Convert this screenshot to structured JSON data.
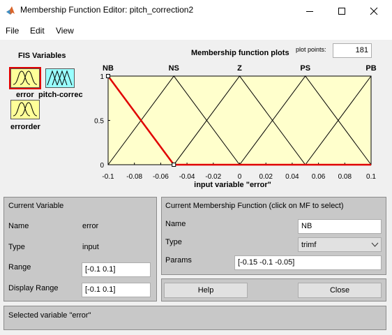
{
  "window": {
    "title": "Membership Function Editor: pitch_correction2"
  },
  "menu": [
    "File",
    "Edit",
    "View"
  ],
  "fis": {
    "heading": "FIS Variables",
    "vars": [
      {
        "label": "error",
        "color": "#ffff99",
        "selected": true
      },
      {
        "label": "pitch-correc",
        "color": "#99ffff",
        "selected": false
      },
      {
        "label": "errorder",
        "color": "#ffff99",
        "selected": false
      }
    ]
  },
  "plot": {
    "title": "Membership function plots",
    "plot_points_label": "plot points:",
    "plot_points_value": "181",
    "xlabel": "input variable \"error\"",
    "mf_labels": [
      "NB",
      "NS",
      "Z",
      "PS",
      "PB"
    ]
  },
  "chart_data": {
    "type": "line",
    "xlim": [
      -0.1,
      0.1
    ],
    "ylim": [
      0,
      1
    ],
    "xticks": [
      "-0.1",
      "-0.08",
      "-0.06",
      "-0.04",
      "-0.02",
      "0",
      "0.02",
      "0.04",
      "0.06",
      "0.08",
      "0.1"
    ],
    "yticks": [
      "0",
      "0.5",
      "1"
    ],
    "xlabel": "input variable \"error\"",
    "series": [
      {
        "name": "NB",
        "params": [
          -0.15,
          -0.1,
          -0.05
        ],
        "selected": true
      },
      {
        "name": "NS",
        "params": [
          -0.1,
          -0.05,
          0
        ],
        "selected": false
      },
      {
        "name": "Z",
        "params": [
          -0.05,
          0,
          0.05
        ],
        "selected": false
      },
      {
        "name": "PS",
        "params": [
          0,
          0.05,
          0.1
        ],
        "selected": false
      },
      {
        "name": "PB",
        "params": [
          0.05,
          0.1,
          0.15
        ],
        "selected": false
      }
    ],
    "colors": {
      "plot_bg": "#ffffcc",
      "line": "#000000",
      "selected": "#e00000"
    }
  },
  "current_variable": {
    "heading": "Current Variable",
    "name_label": "Name",
    "name_value": "error",
    "type_label": "Type",
    "type_value": "input",
    "range_label": "Range",
    "range_value": "[-0.1 0.1]",
    "display_range_label": "Display Range",
    "display_range_value": "[-0.1 0.1]"
  },
  "current_mf": {
    "heading": "Current Membership Function (click on MF to select)",
    "name_label": "Name",
    "name_value": "NB",
    "type_label": "Type",
    "type_value": "trimf",
    "params_label": "Params",
    "params_value": "[-0.15 -0.1 -0.05]"
  },
  "buttons": {
    "help": "Help",
    "close": "Close"
  },
  "status": "Selected variable \"error\""
}
